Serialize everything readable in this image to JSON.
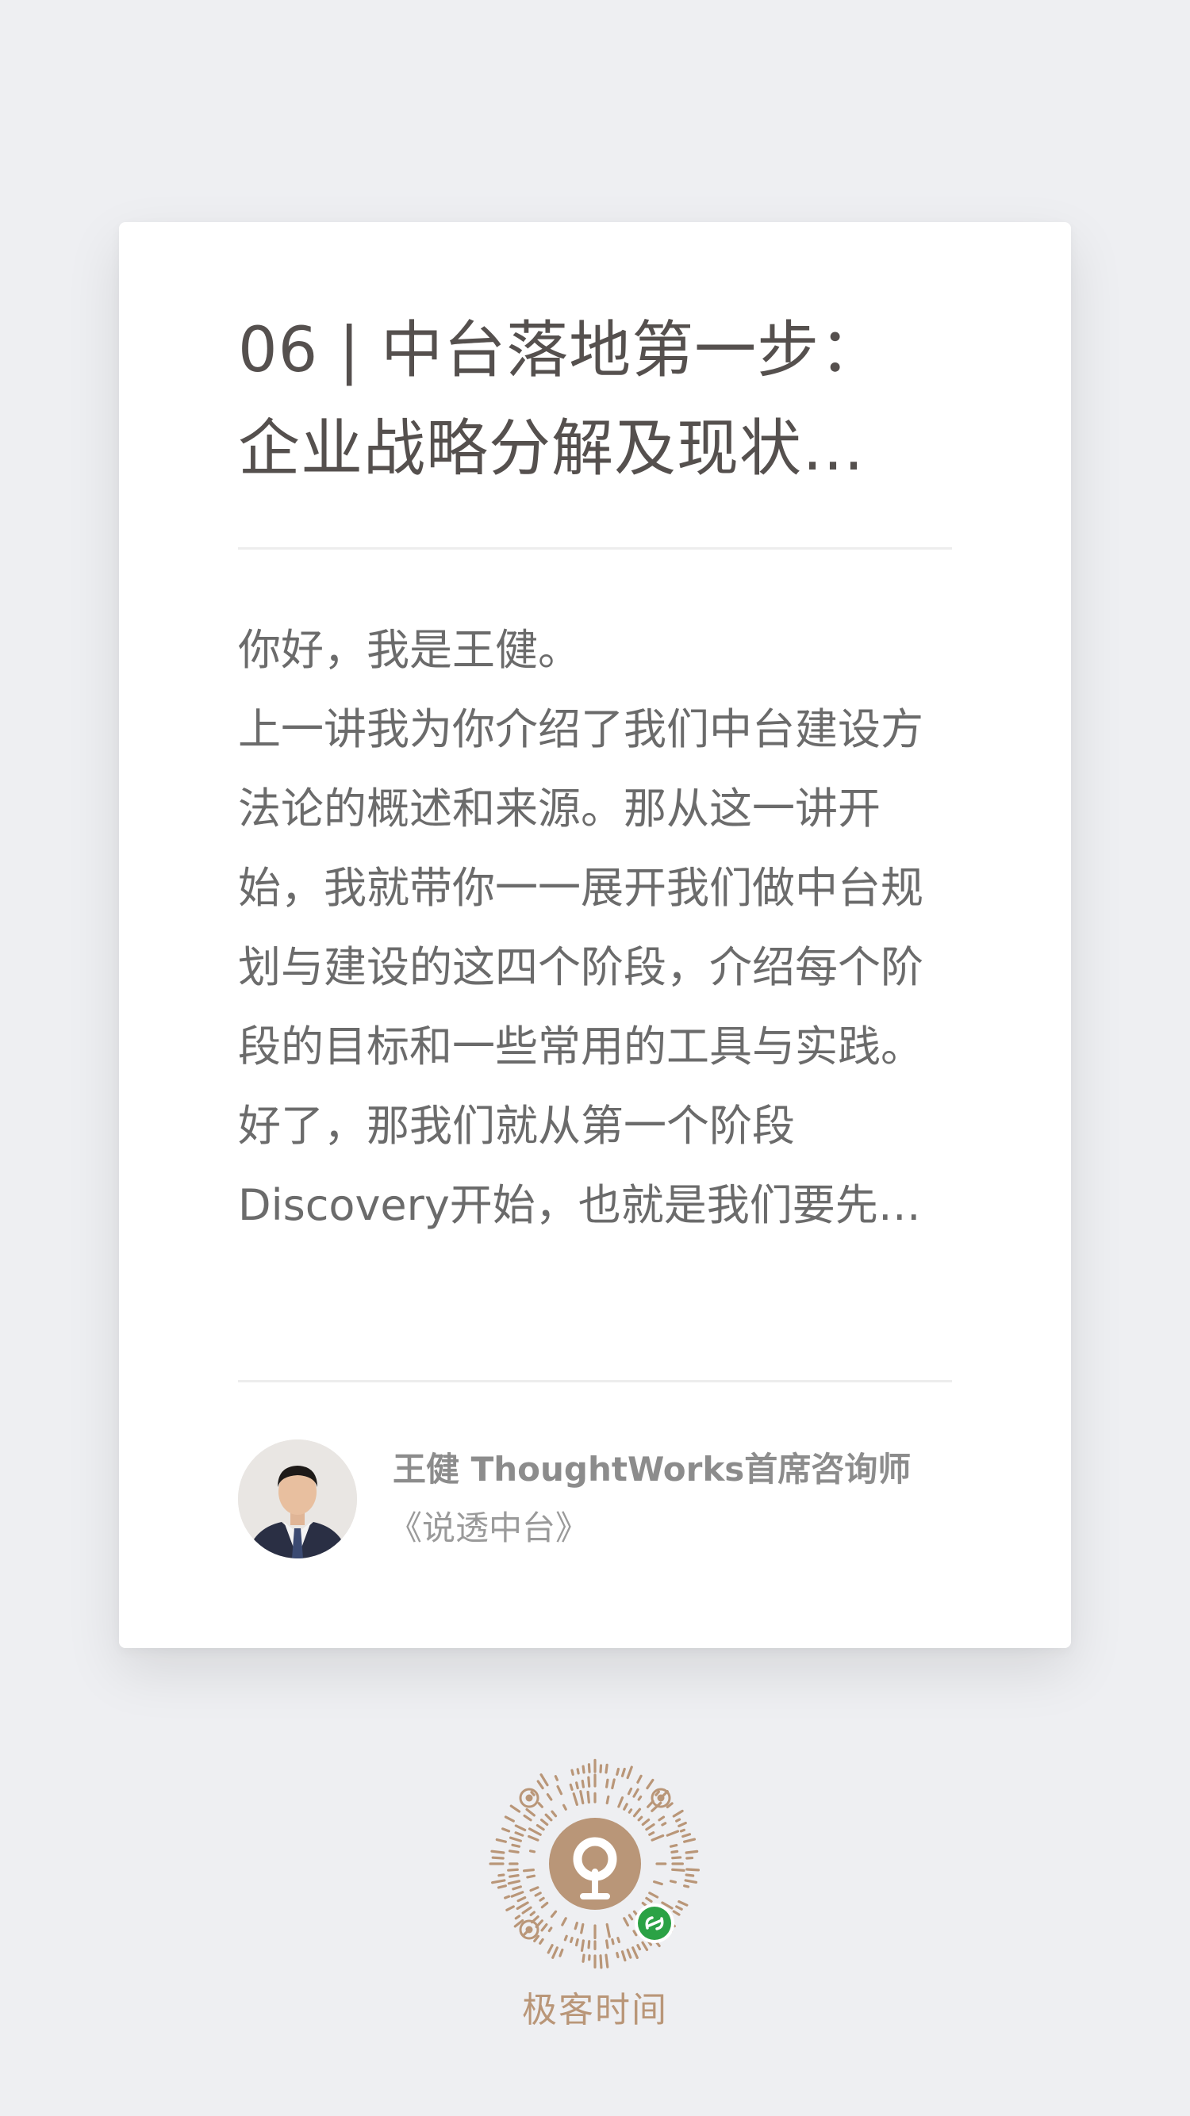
{
  "article": {
    "title_lines": [
      "06 | 中台落地第一步：",
      "企业战略分解及现状…"
    ],
    "body_lines": [
      "你好，我是王健。",
      "上一讲我为你介绍了我们中台建设方",
      "法论的概述和来源。那从这一讲开",
      "始，我就带你一一展开我们做中台规",
      "划与建设的这四个阶段，介绍每个阶",
      "段的目标和一些常用的工具与实践。",
      "好了，那我们就从第一个阶段",
      "Discovery开始，也就是我们要先…"
    ]
  },
  "author": {
    "name_title": "王健 ThoughtWorks首席咨询师",
    "course": "《说透中台》",
    "avatar_icon": "author-portrait"
  },
  "footer": {
    "qr_icon": "mini-program-code-icon",
    "brand": "极客时间"
  },
  "colors": {
    "background": "#eeeff2",
    "card": "#ffffff",
    "title_text": "#55504e",
    "body_text": "#6b6b6b",
    "brand": "#b99678",
    "mini_program_badge": "#2ba245"
  }
}
